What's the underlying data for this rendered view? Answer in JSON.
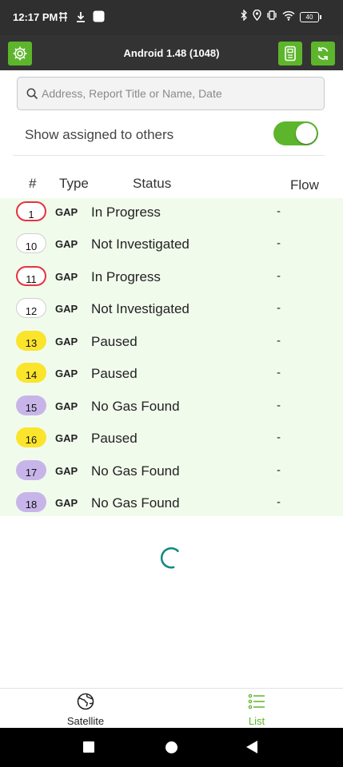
{
  "status_bar": {
    "time": "12:17 PM",
    "battery": "40"
  },
  "header": {
    "title": "Android 1.48 (1048)"
  },
  "search": {
    "placeholder": "Address, Report Title or Name, Date",
    "value": ""
  },
  "assigned_toggle": {
    "label": "Show assigned to others",
    "on": true
  },
  "table": {
    "columns": {
      "number": "#",
      "type": "Type",
      "status": "Status",
      "flow": "Flow"
    },
    "rows": [
      {
        "number": "1",
        "type": "GAP",
        "status": "In Progress",
        "flow": "-",
        "badge": "red"
      },
      {
        "number": "10",
        "type": "GAP",
        "status": "Not Investigated",
        "flow": "-",
        "badge": "white"
      },
      {
        "number": "11",
        "type": "GAP",
        "status": "In Progress",
        "flow": "-",
        "badge": "red"
      },
      {
        "number": "12",
        "type": "GAP",
        "status": "Not Investigated",
        "flow": "-",
        "badge": "white"
      },
      {
        "number": "13",
        "type": "GAP",
        "status": "Paused",
        "flow": "-",
        "badge": "yellow"
      },
      {
        "number": "14",
        "type": "GAP",
        "status": "Paused",
        "flow": "-",
        "badge": "yellow"
      },
      {
        "number": "15",
        "type": "GAP",
        "status": "No Gas Found",
        "flow": "-",
        "badge": "purple"
      },
      {
        "number": "16",
        "type": "GAP",
        "status": "Paused",
        "flow": "-",
        "badge": "yellow"
      },
      {
        "number": "17",
        "type": "GAP",
        "status": "No Gas Found",
        "flow": "-",
        "badge": "purple"
      },
      {
        "number": "18",
        "type": "GAP",
        "status": "No Gas Found",
        "flow": "-",
        "badge": "purple"
      }
    ]
  },
  "bottom_nav": {
    "satellite": {
      "label": "Satellite",
      "icon": "globe-icon"
    },
    "list": {
      "label": "List",
      "icon": "list-icon",
      "active": true
    }
  },
  "colors": {
    "accent_green": "#5db52c",
    "list_bg": "#f1fbec",
    "badge_red": "#e5333f",
    "badge_yellow": "#fbe42c",
    "badge_purple": "#c7b5ea",
    "spinner": "#138a80"
  }
}
